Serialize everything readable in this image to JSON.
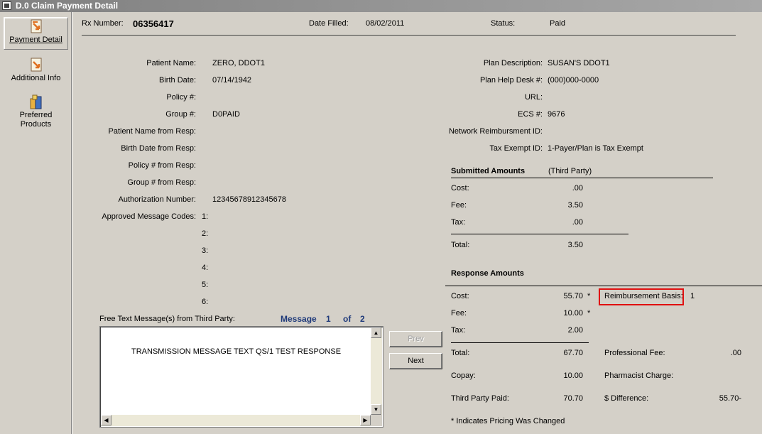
{
  "window": {
    "title": "D.0 Claim Payment Detail"
  },
  "sidebar": {
    "items": [
      {
        "label": "Payment Detail",
        "icon": "payment-detail-icon",
        "active": true
      },
      {
        "label": "Additional Info",
        "icon": "additional-info-icon",
        "active": false
      },
      {
        "label_line1": "Preferred",
        "label_line2": "Products",
        "icon": "preferred-products-icon",
        "active": false
      }
    ]
  },
  "header": {
    "rx_label": "Rx Number:",
    "rx_value": "06356417",
    "date_label": "Date Filled:",
    "date_value": "08/02/2011",
    "status_label": "Status:",
    "status_value": "Paid"
  },
  "patient": {
    "name_label": "Patient Name:",
    "name_value": "ZERO, DDOT1",
    "birth_label": "Birth Date:",
    "birth_value": "07/14/1942",
    "policy_label": "Policy #:",
    "policy_value": "",
    "group_label": "Group #:",
    "group_value": "D0PAID",
    "name_resp_label": "Patient Name from Resp:",
    "birth_resp_label": "Birth Date from Resp:",
    "policy_resp_label": "Policy # from Resp:",
    "group_resp_label": "Group # from Resp:",
    "auth_label": "Authorization Number:",
    "auth_value": "12345678912345678",
    "approved_label": "Approved Message Codes:",
    "approved_codes": [
      "1:",
      "2:",
      "3:",
      "4:",
      "5:",
      "6:"
    ]
  },
  "plan": {
    "desc_label": "Plan Description:",
    "desc_value": "SUSAN'S DDOT1",
    "helpdesk_label": "Plan Help Desk #:",
    "helpdesk_value": "(000)000-0000",
    "url_label": "URL:",
    "url_value": "",
    "ecs_label": "ECS #:",
    "ecs_value": "9676",
    "network_label": "Network Reimbursment ID:",
    "network_value": "",
    "tax_label": "Tax Exempt ID:",
    "tax_value": "1-Payer/Plan is Tax Exempt"
  },
  "submitted": {
    "heading": "Submitted Amounts",
    "subheading": "(Third Party)",
    "cost_label": "Cost:",
    "cost_value": ".00",
    "fee_label": "Fee:",
    "fee_value": "3.50",
    "tax_label": "Tax:",
    "tax_value": ".00",
    "total_label": "Total:",
    "total_value": "3.50"
  },
  "response": {
    "heading": "Response Amounts",
    "cost_label": "Cost:",
    "cost_value": "55.70",
    "cost_mark": "*",
    "fee_label": "Fee:",
    "fee_value": "10.00",
    "fee_mark": "*",
    "tax_label": "Tax:",
    "tax_value": "2.00",
    "total_label": "Total:",
    "total_value": "67.70",
    "copay_label": "Copay:",
    "copay_value": "10.00",
    "tpp_label": "Third Party Paid:",
    "tpp_value": "70.70",
    "reimb_label": "Reimbursement Basis:",
    "reimb_value": "1",
    "prof_label": "Professional Fee:",
    "prof_value": ".00",
    "pharm_label": "Pharmacist Charge:",
    "pharm_value": "",
    "diff_label": "$ Difference:",
    "diff_value": "55.70-",
    "footnote": "* Indicates Pricing Was Changed"
  },
  "messages": {
    "label": "Free Text Message(s) from Third Party:",
    "nav_word": "Message",
    "current": "1",
    "of_word": "of",
    "total": "2",
    "text": "TRANSMISSION MESSAGE TEXT QS/1 TEST RESPONSE",
    "prev_label": "Prev",
    "next_label": "Next"
  }
}
